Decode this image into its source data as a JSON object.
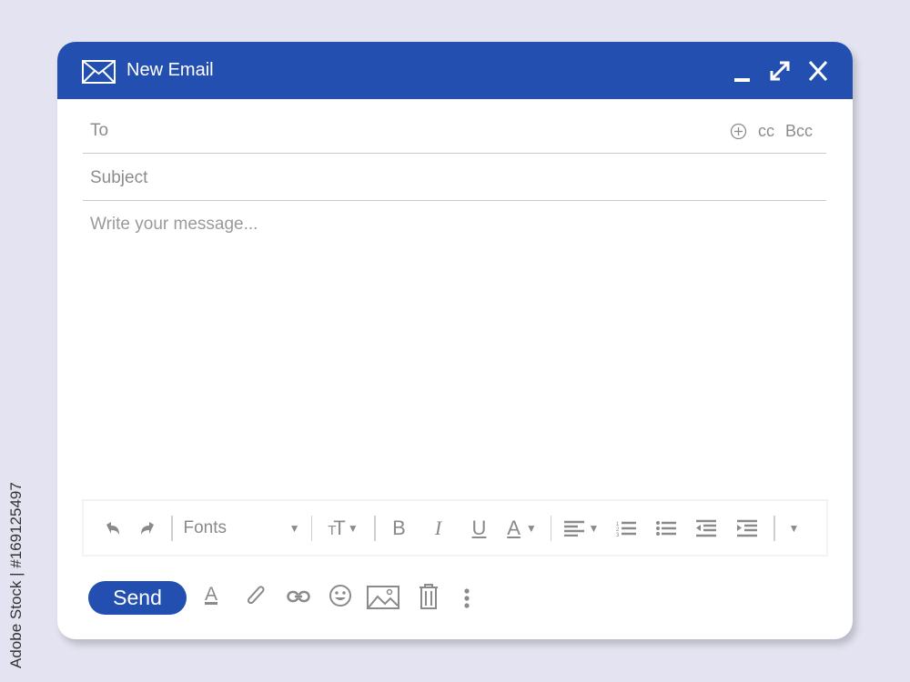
{
  "window": {
    "title": "New Email"
  },
  "fields": {
    "to_label": "To",
    "cc_label": "cc",
    "bcc_label": "Bcc",
    "subject_placeholder": "Subject",
    "message_placeholder": "Write your message..."
  },
  "toolbar": {
    "font_select": "Fonts",
    "bold": "B",
    "italic": "I",
    "underline": "U",
    "text_color": "A"
  },
  "footer": {
    "send_label": "Send",
    "text_format": "A"
  },
  "watermark": "Adobe Stock | #169125497",
  "colors": {
    "accent": "#2350b0",
    "background": "#e3e3f1",
    "icon_gray": "#8a8a8a"
  }
}
